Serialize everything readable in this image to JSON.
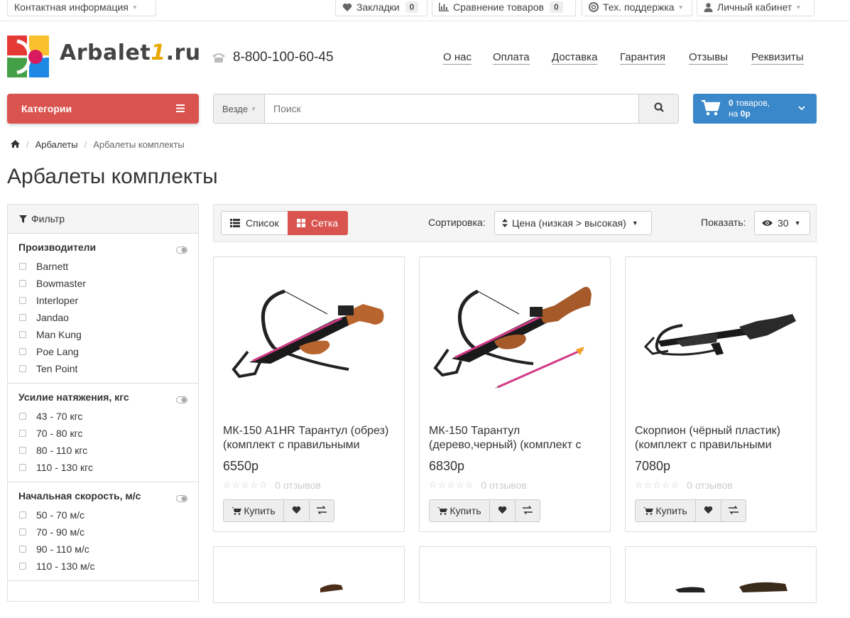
{
  "topbar": {
    "contact": "Контактная информация",
    "bookmarks": "Закладки",
    "bookmarks_count": "0",
    "compare": "Сравнение товаров",
    "compare_count": "0",
    "support": "Тех. поддержка",
    "account": "Личный кабинет"
  },
  "header": {
    "logo_main": "Arbalet",
    "logo_one": "1",
    "logo_tld": ".ru",
    "phone": "8-800-100-60-45",
    "nav": [
      "О нас",
      "Оплата",
      "Доставка",
      "Гарантия",
      "Отзывы",
      "Реквизиты"
    ]
  },
  "categories_label": "Категории",
  "search": {
    "scope": "Везде",
    "placeholder": "Поиск"
  },
  "cart": {
    "count": "0",
    "count_suffix": " товаров,",
    "total_prefix": "на ",
    "total": "0р"
  },
  "breadcrumb": [
    "Арбалеты",
    "Арбалеты комплекты"
  ],
  "page_title": "Арбалеты комплекты",
  "filter": {
    "title": "Фильтр",
    "groups": [
      {
        "title": "Производители",
        "items": [
          "Barnett",
          "Bowmaster",
          "Interloper",
          "Jandao",
          "Man Kung",
          "Poe Lang",
          "Ten Point"
        ]
      },
      {
        "title": "Усилие натяжения, кгс",
        "items": [
          "43 - 70 кгс",
          "70 - 80 кгс",
          "80 - 110 кгс",
          "110 - 130 кгс"
        ]
      },
      {
        "title": "Начальная скорость, м/с",
        "items": [
          "50 - 70 м/с",
          "70 - 90 м/с",
          "90 - 110 м/с",
          "110 - 130 м/с"
        ]
      }
    ]
  },
  "toolbar": {
    "list_label": "Список",
    "grid_label": "Сетка",
    "sort_label": "Сортировка:",
    "sort_value": "Цена (низкая > высокая)",
    "show_label": "Показать:",
    "show_value": "30"
  },
  "products": [
    {
      "title": "МК-150 A1HR Тарантул (обрез) (комплект с правильными",
      "price": "6550р",
      "reviews": "0 отзывов",
      "buy": "Купить",
      "colors": {
        "stock": "#b8642e"
      }
    },
    {
      "title": "МК-150 Тарантул (дерево,черный) (комплект с",
      "price": "6830р",
      "reviews": "0 отзывов",
      "buy": "Купить",
      "colors": {
        "stock": "#a65a2a"
      }
    },
    {
      "title": "Скорпион (чёрный пластик) (комплект с правильными",
      "price": "7080р",
      "reviews": "0 отзывов",
      "buy": "Купить",
      "colors": {
        "stock": "#2a2a2a"
      }
    }
  ],
  "colors": {
    "accent_red": "#d9534f",
    "cart_blue": "#3a87c9"
  }
}
